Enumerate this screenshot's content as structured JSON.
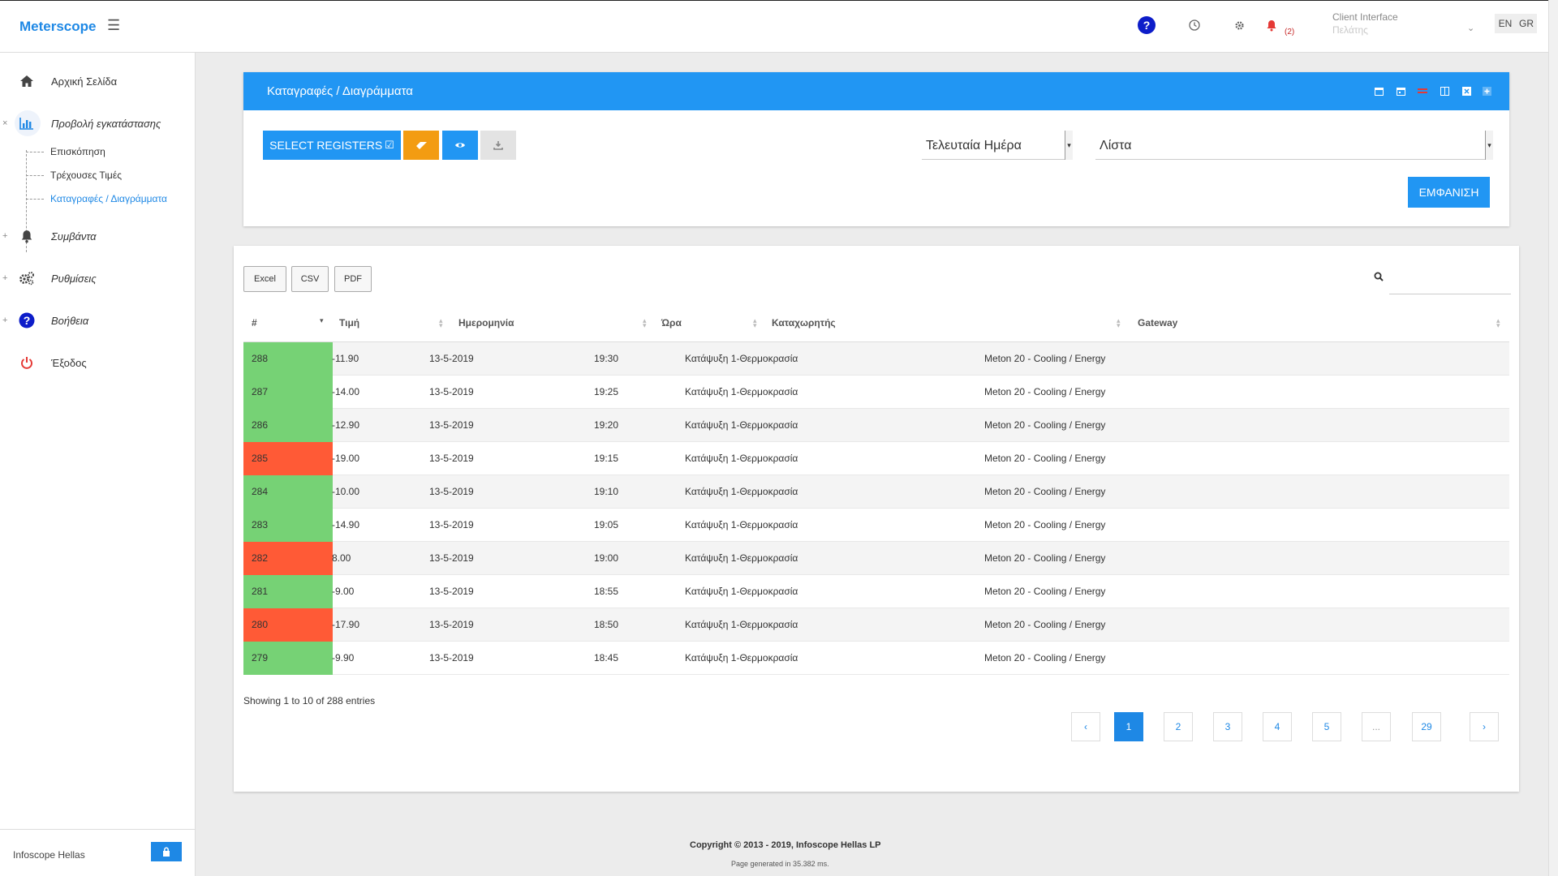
{
  "app": {
    "brand": "Meterscope"
  },
  "topbar": {
    "notifications_count": "(2)",
    "client_label": "Client Interface",
    "client_role": "Πελάτης",
    "languages": [
      "EN",
      "GR"
    ]
  },
  "sidebar": {
    "items": [
      {
        "label": "Αρχική Σελίδα",
        "icon": "home-icon"
      },
      {
        "label": "Προβολή εγκατάστασης",
        "icon": "bar-chart-icon",
        "expander": "×"
      },
      {
        "label": "Συμβάντα",
        "icon": "bell-icon",
        "expander": "+"
      },
      {
        "label": "Ρυθμίσεις",
        "icon": "gears-icon",
        "expander": "+"
      },
      {
        "label": "Βοήθεια",
        "icon": "help-icon",
        "expander": "+"
      },
      {
        "label": "Έξοδος",
        "icon": "power-icon"
      }
    ],
    "subitems": [
      {
        "label": "Επισκόπηση"
      },
      {
        "label": "Τρέχουσες Τιμές"
      },
      {
        "label": "Καταγραφές / Διαγράμματα"
      }
    ],
    "footer_company": "Infoscope Hellas"
  },
  "panel": {
    "title": "Καταγραφές / Διαγράμματα",
    "select_registers": "SELECT REGISTERS",
    "period_value": "Τελευταία Ημέρα",
    "view_value": "Λίστα",
    "show_button": "ΕΜΦΑΝΙΣΗ"
  },
  "table": {
    "export_buttons": [
      "Excel",
      "CSV",
      "PDF"
    ],
    "columns": [
      "#",
      "Τιμή",
      "Ημερομηνία",
      "Ώρα",
      "Καταχωρητής",
      "Gateway"
    ],
    "rows": [
      {
        "id": "288",
        "value": "-11.90",
        "date": "13-5-2019",
        "time": "19:30",
        "register": "Κατάψυξη 1-Θερμοκρασία",
        "gateway": "Meton 20 - Cooling / Energy",
        "status": "ok"
      },
      {
        "id": "287",
        "value": "-14.00",
        "date": "13-5-2019",
        "time": "19:25",
        "register": "Κατάψυξη 1-Θερμοκρασία",
        "gateway": "Meton 20 - Cooling / Energy",
        "status": "ok"
      },
      {
        "id": "286",
        "value": "-12.90",
        "date": "13-5-2019",
        "time": "19:20",
        "register": "Κατάψυξη 1-Θερμοκρασία",
        "gateway": "Meton 20 - Cooling / Energy",
        "status": "ok"
      },
      {
        "id": "285",
        "value": "-19.00",
        "date": "13-5-2019",
        "time": "19:15",
        "register": "Κατάψυξη 1-Θερμοκρασία",
        "gateway": "Meton 20 - Cooling / Energy",
        "status": "alarm"
      },
      {
        "id": "284",
        "value": "-10.00",
        "date": "13-5-2019",
        "time": "19:10",
        "register": "Κατάψυξη 1-Θερμοκρασία",
        "gateway": "Meton 20 - Cooling / Energy",
        "status": "ok"
      },
      {
        "id": "283",
        "value": "-14.90",
        "date": "13-5-2019",
        "time": "19:05",
        "register": "Κατάψυξη 1-Θερμοκρασία",
        "gateway": "Meton 20 - Cooling / Energy",
        "status": "ok"
      },
      {
        "id": "282",
        "value": "8.00",
        "date": "13-5-2019",
        "time": "19:00",
        "register": "Κατάψυξη 1-Θερμοκρασία",
        "gateway": "Meton 20 - Cooling / Energy",
        "status": "alarm"
      },
      {
        "id": "281",
        "value": "-9.00",
        "date": "13-5-2019",
        "time": "18:55",
        "register": "Κατάψυξη 1-Θερμοκρασία",
        "gateway": "Meton 20 - Cooling / Energy",
        "status": "ok"
      },
      {
        "id": "280",
        "value": "-17.90",
        "date": "13-5-2019",
        "time": "18:50",
        "register": "Κατάψυξη 1-Θερμοκρασία",
        "gateway": "Meton 20 - Cooling / Energy",
        "status": "alarm"
      },
      {
        "id": "279",
        "value": "-9.90",
        "date": "13-5-2019",
        "time": "18:45",
        "register": "Κατάψυξη 1-Θερμοκρασία",
        "gateway": "Meton 20 - Cooling / Energy",
        "status": "ok"
      }
    ],
    "info": "Showing 1 to 10 of 288 entries",
    "pagination": [
      "‹",
      "1",
      "2",
      "3",
      "4",
      "5",
      "...",
      "29",
      "›"
    ],
    "current_page": "1"
  },
  "colors": {
    "accent": "#2196f3",
    "ok": "#76d275",
    "alarm": "#ff5a36",
    "erase": "#f39c12"
  },
  "footer": {
    "copyright": "Copyright © 2013 - 2019, Infoscope Hellas LP",
    "generated": "Page generated in 35.382 ms."
  }
}
